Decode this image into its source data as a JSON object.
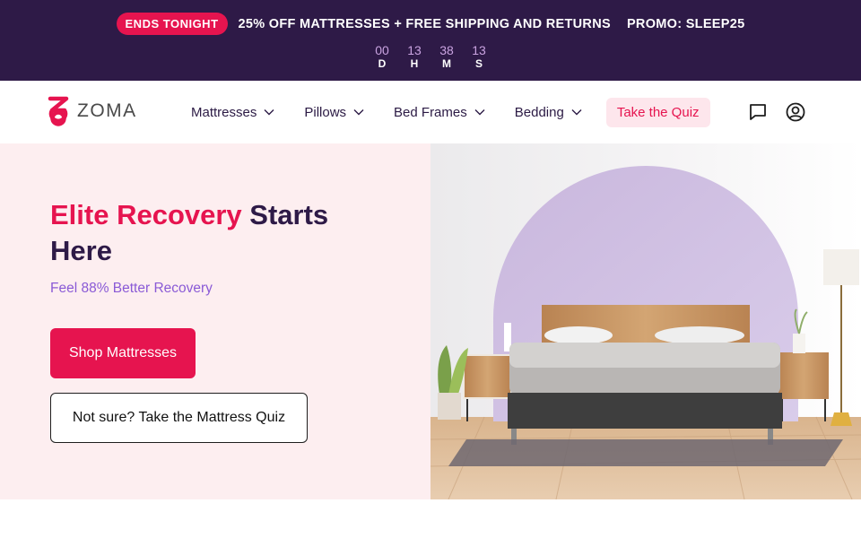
{
  "promo": {
    "badge": "ENDS TONIGHT",
    "text": "25% OFF MATTRESSES + FREE SHIPPING AND RETURNS",
    "code": "PROMO: SLEEP25",
    "countdown": [
      {
        "value": "00",
        "label": "D"
      },
      {
        "value": "13",
        "label": "H"
      },
      {
        "value": "38",
        "label": "M"
      },
      {
        "value": "13",
        "label": "S"
      }
    ]
  },
  "header": {
    "logo_text": "ZOMA",
    "nav": [
      {
        "label": "Mattresses"
      },
      {
        "label": "Pillows"
      },
      {
        "label": "Bed Frames"
      },
      {
        "label": "Bedding"
      }
    ],
    "quiz_label": "Take the Quiz",
    "icons": [
      "chat-icon",
      "account-icon"
    ]
  },
  "hero": {
    "title_accent": "Elite Recovery",
    "title_rest": " Starts Here",
    "subtitle": "Feel 88% Better Recovery",
    "primary_cta": "Shop Mattresses",
    "secondary_cta": "Not sure? Take the Mattress Quiz"
  },
  "colors": {
    "brand": "#e6144f",
    "promo_bg": "#2e1a47",
    "hero_bg": "#fdeef0",
    "subtitle": "#8a5ad6"
  }
}
